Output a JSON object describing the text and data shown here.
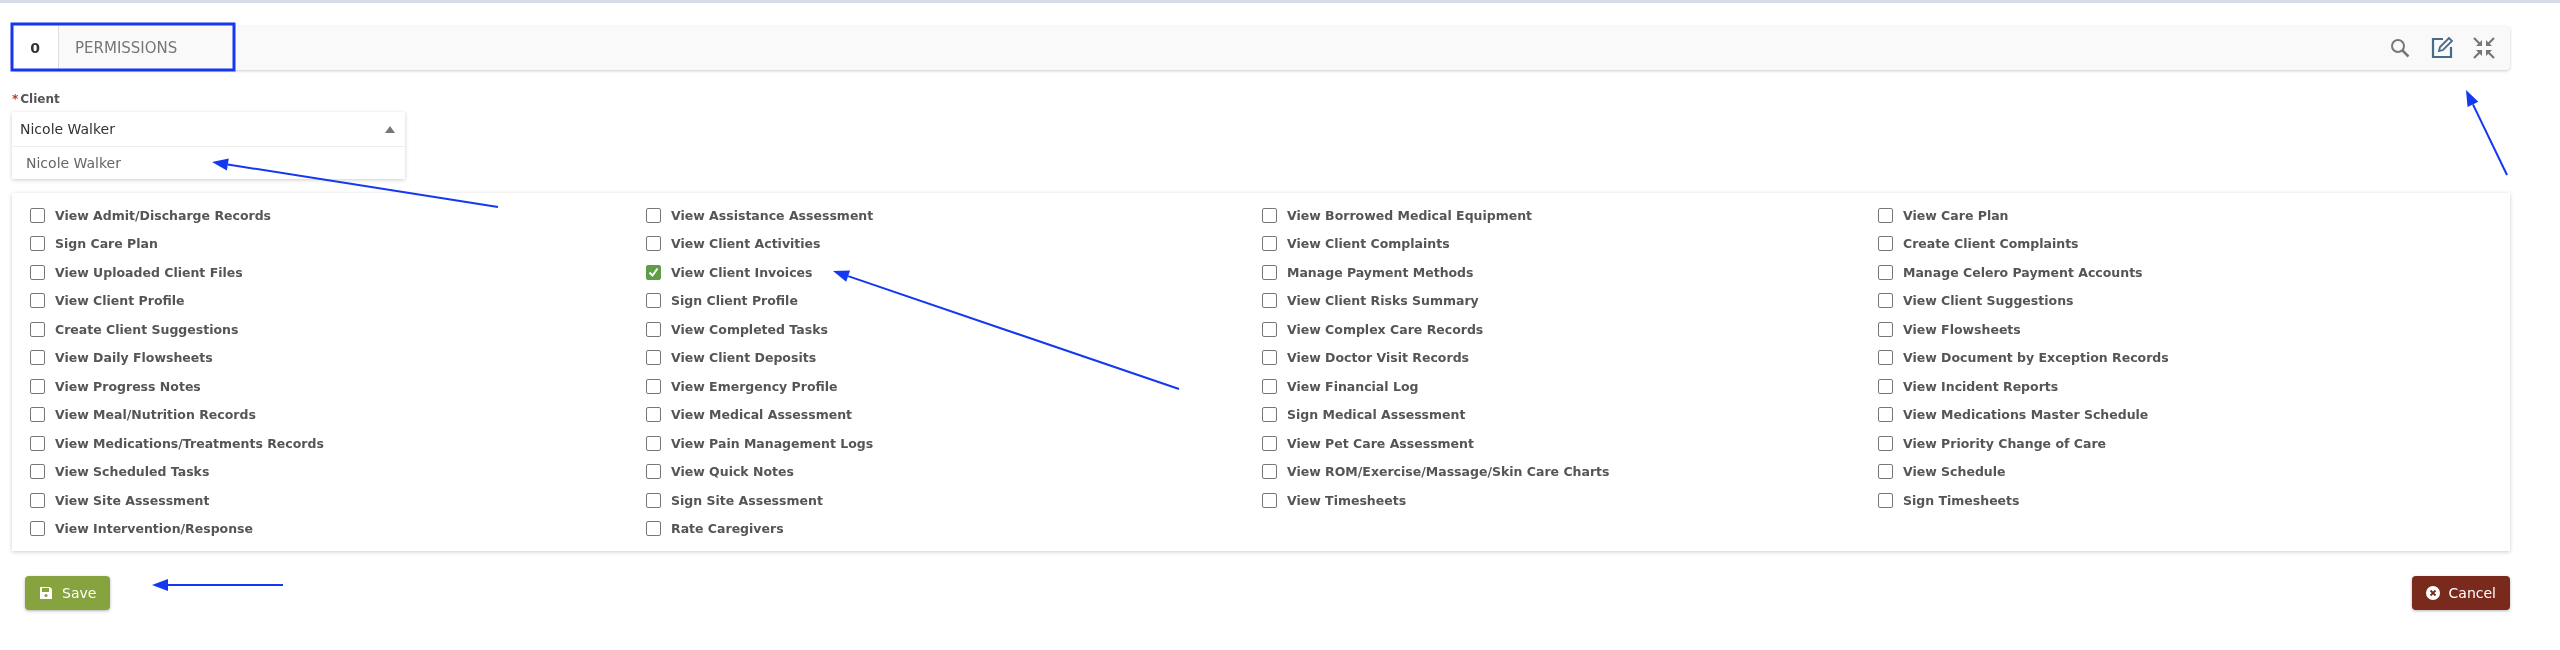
{
  "header": {
    "count": "0",
    "title": "PERMISSIONS"
  },
  "client_field": {
    "required_mark": "*",
    "label": "Client",
    "value": "Nicole Walker",
    "expanded": true,
    "options": [
      {
        "label": "Nicole Walker"
      }
    ]
  },
  "permissions": [
    {
      "label": "View Admit/Discharge Records",
      "checked": false
    },
    {
      "label": "View Assistance Assessment",
      "checked": false
    },
    {
      "label": "View Borrowed Medical Equipment",
      "checked": false
    },
    {
      "label": "View Care Plan",
      "checked": false
    },
    {
      "label": "Sign Care Plan",
      "checked": false
    },
    {
      "label": "View Client Activities",
      "checked": false
    },
    {
      "label": "View Client Complaints",
      "checked": false
    },
    {
      "label": "Create Client Complaints",
      "checked": false
    },
    {
      "label": "View Uploaded Client Files",
      "checked": false
    },
    {
      "label": "View Client Invoices",
      "checked": true
    },
    {
      "label": "Manage Payment Methods",
      "checked": false
    },
    {
      "label": "Manage Celero Payment Accounts",
      "checked": false
    },
    {
      "label": "View Client Profile",
      "checked": false
    },
    {
      "label": "Sign Client Profile",
      "checked": false
    },
    {
      "label": "View Client Risks Summary",
      "checked": false
    },
    {
      "label": "View Client Suggestions",
      "checked": false
    },
    {
      "label": "Create Client Suggestions",
      "checked": false
    },
    {
      "label": "View Completed Tasks",
      "checked": false
    },
    {
      "label": "View Complex Care Records",
      "checked": false
    },
    {
      "label": "View Flowsheets",
      "checked": false
    },
    {
      "label": "View Daily Flowsheets",
      "checked": false
    },
    {
      "label": "View Client Deposits",
      "checked": false
    },
    {
      "label": "View Doctor Visit Records",
      "checked": false
    },
    {
      "label": "View Document by Exception Records",
      "checked": false
    },
    {
      "label": "View Progress Notes",
      "checked": false
    },
    {
      "label": "View Emergency Profile",
      "checked": false
    },
    {
      "label": "View Financial Log",
      "checked": false
    },
    {
      "label": "View Incident Reports",
      "checked": false
    },
    {
      "label": "View Meal/Nutrition Records",
      "checked": false
    },
    {
      "label": "View Medical Assessment",
      "checked": false
    },
    {
      "label": "Sign Medical Assessment",
      "checked": false
    },
    {
      "label": "View Medications Master Schedule",
      "checked": false
    },
    {
      "label": "View Medications/Treatments Records",
      "checked": false
    },
    {
      "label": "View Pain Management Logs",
      "checked": false
    },
    {
      "label": "View Pet Care Assessment",
      "checked": false
    },
    {
      "label": "View Priority Change of Care",
      "checked": false
    },
    {
      "label": "View Scheduled Tasks",
      "checked": false
    },
    {
      "label": "View Quick Notes",
      "checked": false
    },
    {
      "label": "View ROM/Exercise/Massage/Skin Care Charts",
      "checked": false
    },
    {
      "label": "View Schedule",
      "checked": false
    },
    {
      "label": "View Site Assessment",
      "checked": false
    },
    {
      "label": "Sign Site Assessment",
      "checked": false
    },
    {
      "label": "View Timesheets",
      "checked": false
    },
    {
      "label": "Sign Timesheets",
      "checked": false
    },
    {
      "label": "View Intervention/Response",
      "checked": false
    },
    {
      "label": "Rate Caregivers",
      "checked": false
    }
  ],
  "buttons": [
    {
      "label": "Save",
      "kind": "save"
    },
    {
      "label": "Cancel",
      "kind": "cancel"
    }
  ]
}
